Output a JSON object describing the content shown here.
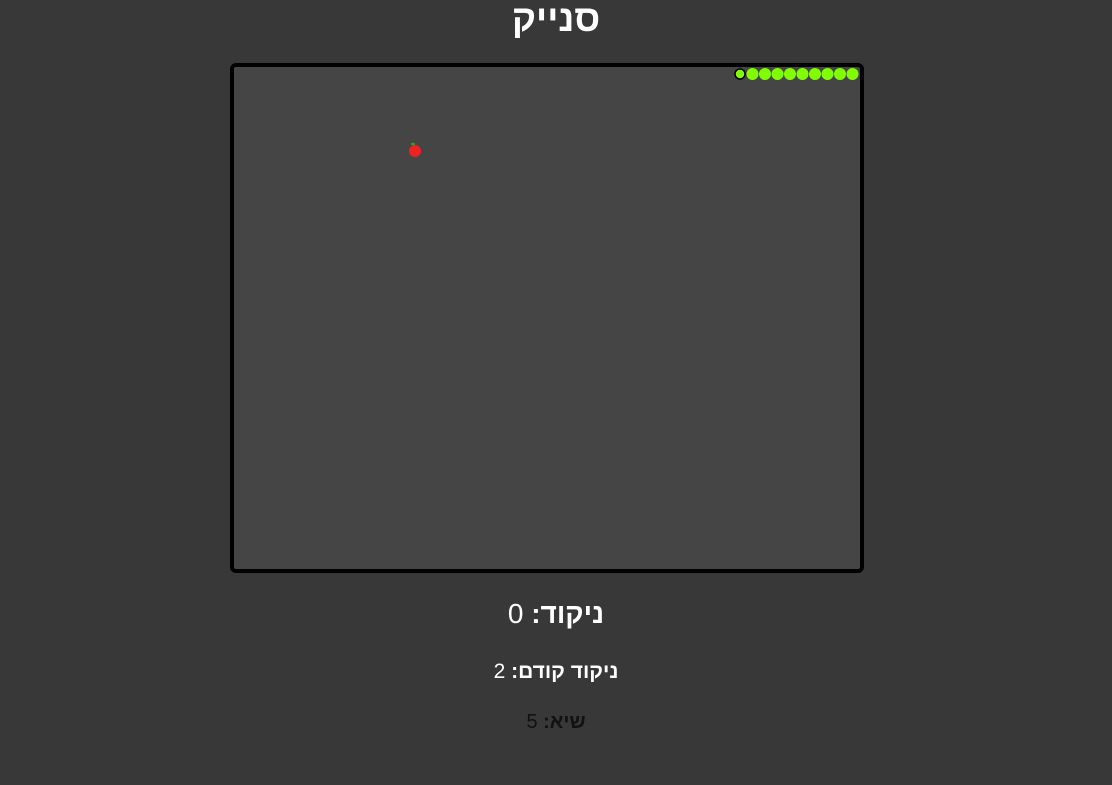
{
  "game": {
    "title": "סנייק"
  },
  "scores": {
    "current_label": "ניקוד: ",
    "current_value": "0",
    "previous_label": "ניקוד קודם: ",
    "previous_value": "2",
    "record_label": "שיא: ",
    "record_value": "5"
  },
  "colors": {
    "background": "#383838",
    "board": "#454545",
    "board_border": "#000000",
    "snake": "#80ff00",
    "snake_head_outline": "#000000",
    "apple": "#ee2222",
    "apple_leaf": "#22aa22"
  },
  "snake": {
    "direction": "left",
    "length": 10
  },
  "apple": {
    "visible": true
  }
}
